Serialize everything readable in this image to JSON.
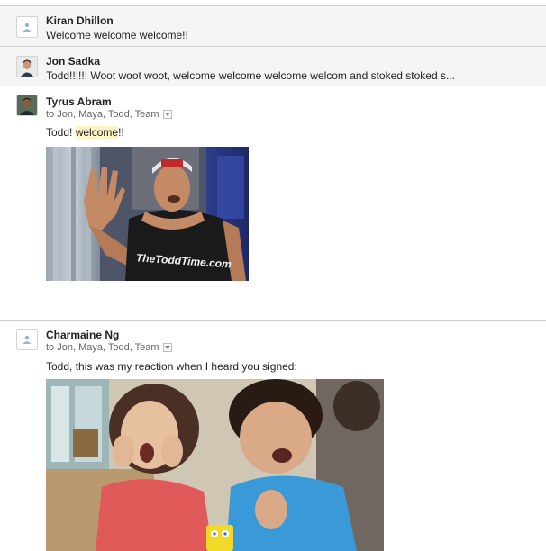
{
  "messages": [
    {
      "sender": "Kiran Dhillon",
      "snippet": "Welcome welcome welcome!!"
    },
    {
      "sender": "Jon Sadka",
      "snippet": "Todd!!!!!! Woot woot woot, welcome welcome welcome welcom and stoked stoked s..."
    },
    {
      "sender": "Tyrus Abram",
      "recipients": "to Jon, Maya, Todd, Team",
      "body_pre": "Todd! ",
      "body_highlight": "welcome",
      "body_post": "!!",
      "gif_shirt_text": "TheToddTime.com"
    },
    {
      "sender": "Charmaine Ng",
      "recipients": "to Jon, Maya, Todd, Team",
      "body": "Todd, this was my reaction when I heard you signed:"
    }
  ],
  "colors": {
    "collapsed_bg": "#f5f5f5",
    "highlight": "#fdf3c4",
    "divider": "#cfcfcf"
  },
  "icons": [
    "default-avatar-icon",
    "dropdown-caret-icon"
  ]
}
